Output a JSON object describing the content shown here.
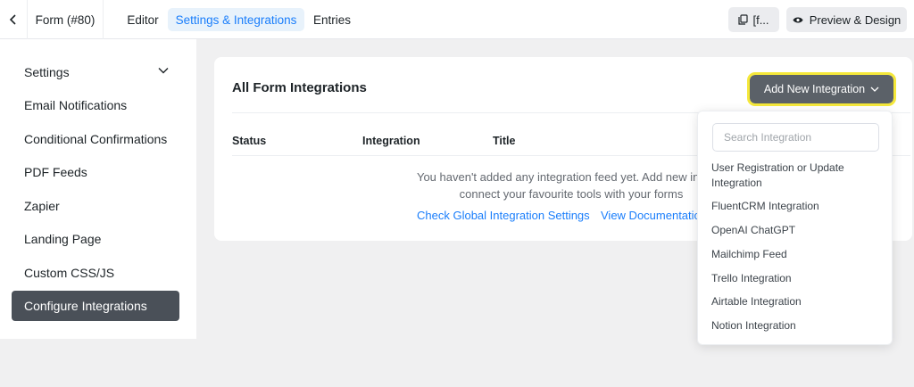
{
  "header": {
    "form_title": "Form (#80)",
    "tabs": [
      {
        "label": "Editor"
      },
      {
        "label": "Settings & Integrations"
      },
      {
        "label": "Entries"
      }
    ],
    "shortcode_label": "[f...",
    "preview_label": "Preview & Design"
  },
  "sidebar": {
    "items": [
      {
        "label": "Settings"
      },
      {
        "label": "Email Notifications"
      },
      {
        "label": "Conditional Confirmations"
      },
      {
        "label": "PDF Feeds"
      },
      {
        "label": "Zapier"
      },
      {
        "label": "Landing Page"
      },
      {
        "label": "Custom CSS/JS"
      },
      {
        "label": "Configure Integrations"
      }
    ]
  },
  "main": {
    "title": "All Form Integrations",
    "add_button_label": "Add New Integration",
    "columns": [
      "Status",
      "Integration",
      "Title"
    ],
    "empty_line1": "You haven't added any integration feed yet. Add new integra",
    "empty_line2": "connect your favourite tools with your forms",
    "link_global": "Check Global Integration Settings",
    "link_docs": "View Documentatio"
  },
  "dropdown": {
    "search_placeholder": "Search Integration",
    "items": [
      "User Registration or Update Integration",
      "FluentCRM Integration",
      "OpenAI ChatGPT",
      "Mailchimp Feed",
      "Trello Integration",
      "Airtable Integration",
      "Notion Integration"
    ]
  },
  "colors": {
    "accent": "#1a7efb",
    "active_sidebar": "#4a5058",
    "add_button": "#5b6168",
    "highlight": "#f5e83a"
  }
}
